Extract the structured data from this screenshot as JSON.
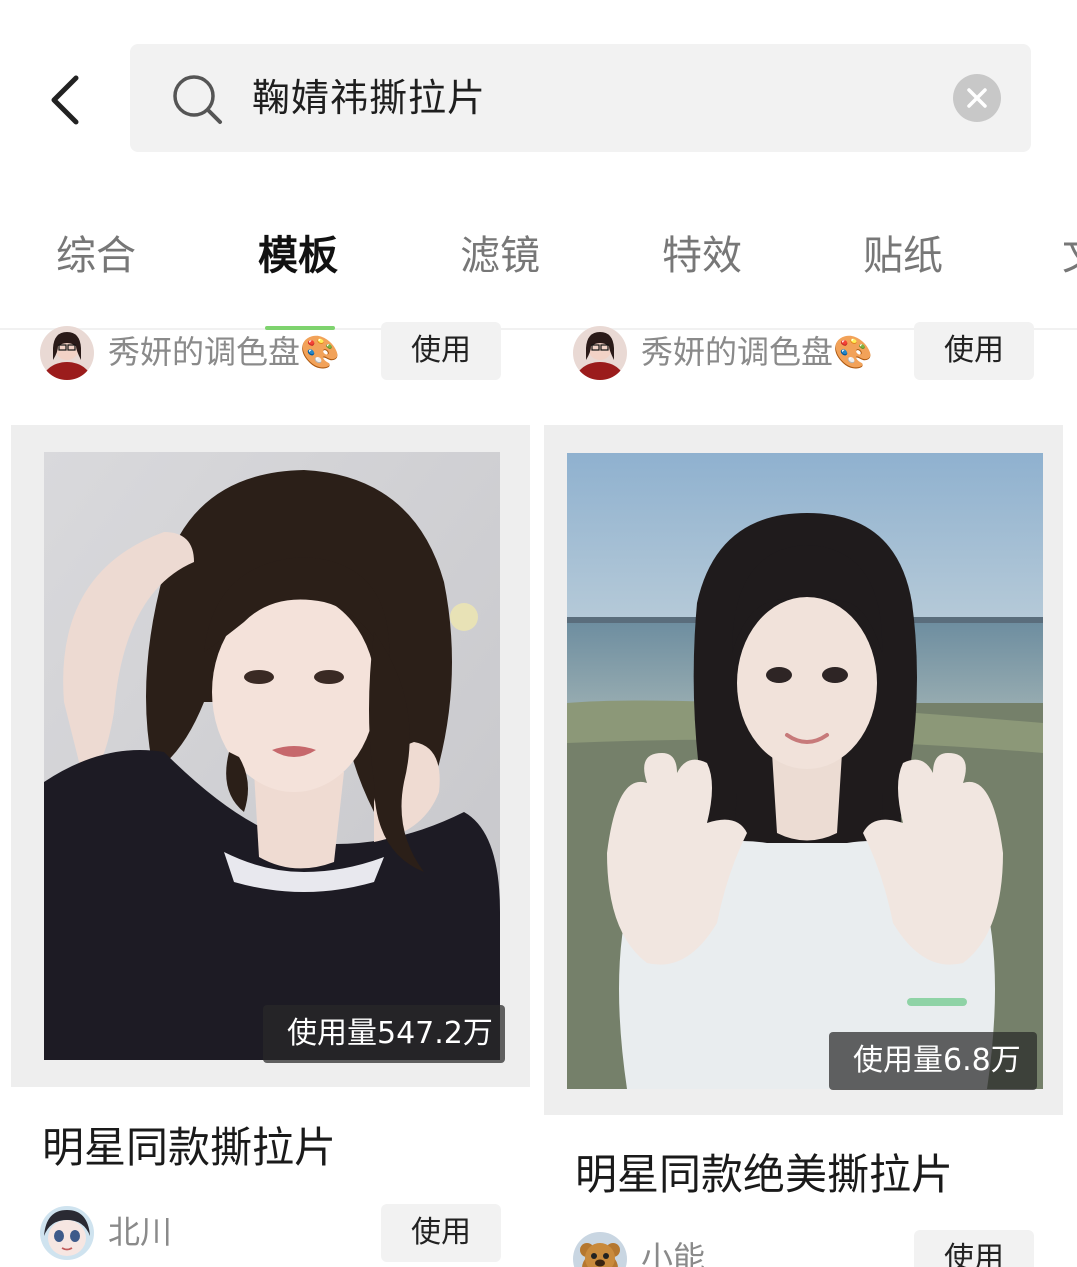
{
  "search": {
    "query": "鞠婧祎撕拉片"
  },
  "tabs": [
    {
      "label": "综合",
      "active": false
    },
    {
      "label": "模板",
      "active": true
    },
    {
      "label": "滤镜",
      "active": false
    },
    {
      "label": "特效",
      "active": false
    },
    {
      "label": "贴纸",
      "active": false
    },
    {
      "label": "文",
      "active": false
    }
  ],
  "top_row": [
    {
      "author": "秀妍的调色盘🎨",
      "use_label": "使用"
    },
    {
      "author": "秀妍的调色盘🎨",
      "use_label": "使用"
    }
  ],
  "cards": [
    {
      "usage": "使用量547.2万",
      "title": "明星同款撕拉片",
      "author": "北川",
      "use_label": "使用"
    },
    {
      "usage": "使用量6.8万",
      "title": "明星同款绝美撕拉片",
      "author": "小能",
      "use_label": "使用"
    }
  ],
  "colors": {
    "accent": "#7ed36e",
    "search_bg": "#f2f2f2",
    "button_bg": "#f2f2f2"
  },
  "icons": [
    "back-arrow-icon",
    "search-icon",
    "clear-icon"
  ]
}
